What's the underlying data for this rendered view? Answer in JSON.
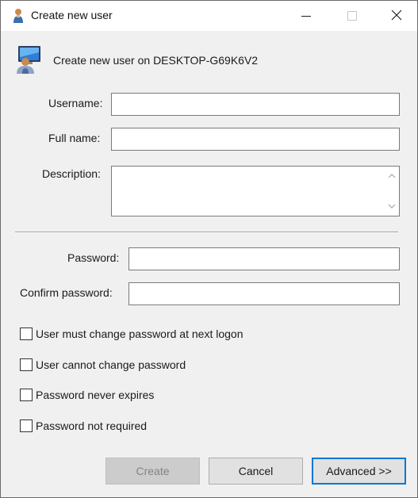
{
  "window": {
    "title": "Create new user",
    "controls": {
      "minimize": "minimize-icon",
      "maximize": "maximize-icon",
      "close": "close-icon"
    }
  },
  "header": {
    "icon": "computer-user-icon",
    "text": "Create new user on DESKTOP-G69K6V2"
  },
  "form": {
    "username_label": "Username:",
    "username_value": "",
    "fullname_label": "Full name:",
    "fullname_value": "",
    "description_label": "Description:",
    "description_value": "",
    "password_label": "Password:",
    "password_value": "",
    "confirm_label": "Confirm password:",
    "confirm_value": ""
  },
  "options": [
    {
      "label": "User must change password at next logon",
      "checked": false
    },
    {
      "label": "User cannot change password",
      "checked": false
    },
    {
      "label": "Password never expires",
      "checked": false
    },
    {
      "label": "Password not required",
      "checked": false
    }
  ],
  "buttons": {
    "create": "Create",
    "cancel": "Cancel",
    "advanced": "Advanced >>"
  },
  "colors": {
    "accent": "#0078d7",
    "disabled_text": "#838383"
  }
}
